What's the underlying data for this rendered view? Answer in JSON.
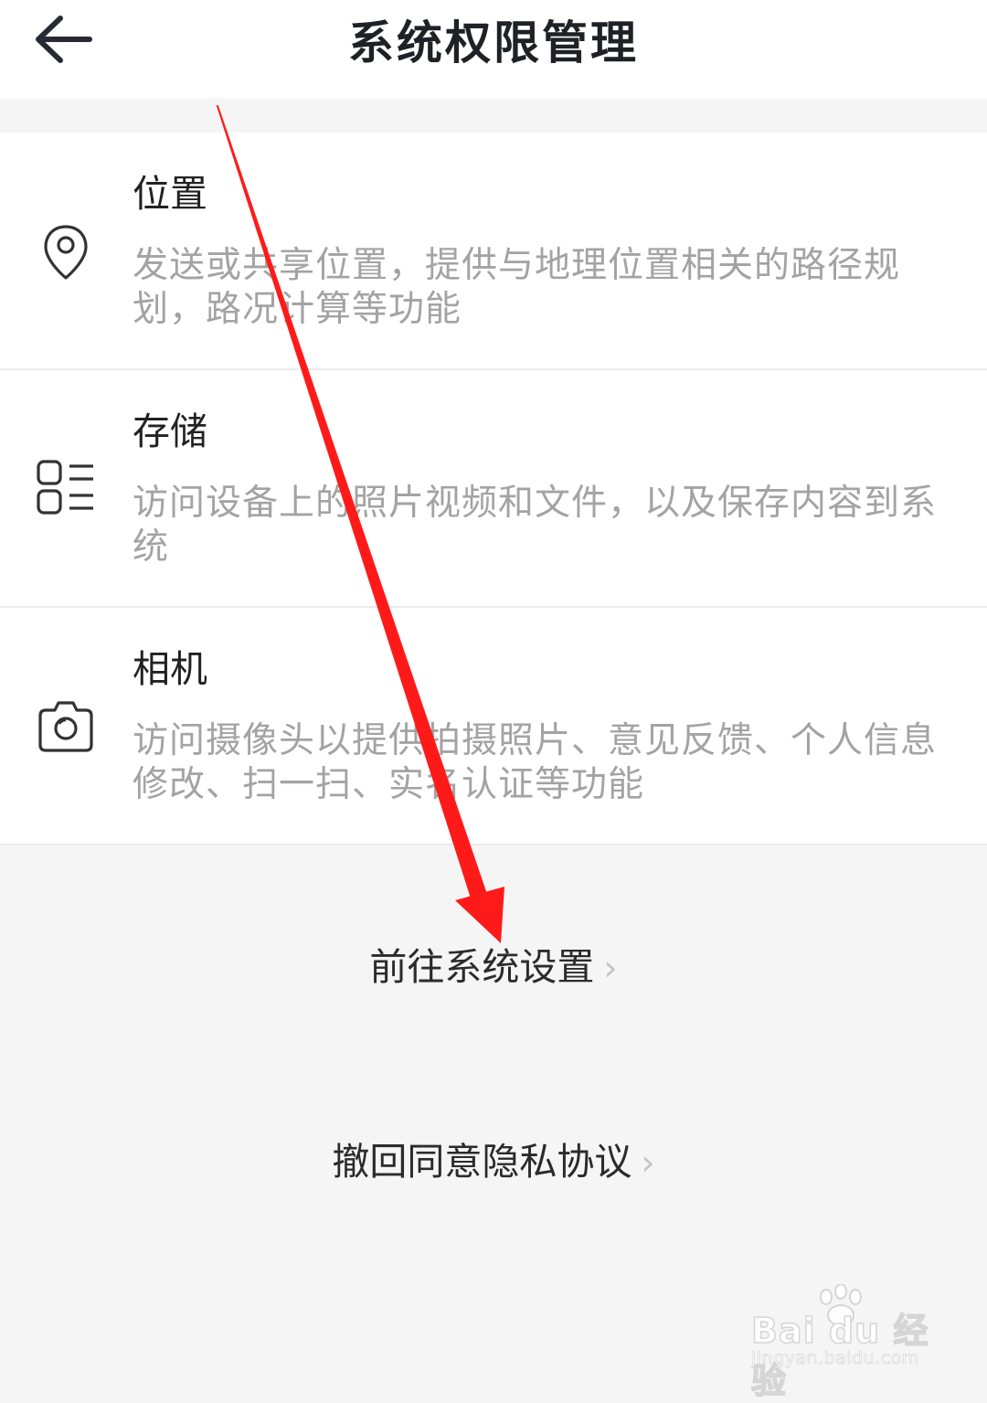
{
  "header": {
    "title": "系统权限管理",
    "back_icon": "arrow-left-icon"
  },
  "permissions": [
    {
      "title": "位置",
      "description": "发送或共享位置，提供与地理位置相关的路径规划，路况计算等功能",
      "icon": "location-pin-icon"
    },
    {
      "title": "存储",
      "description": "访问设备上的照片视频和文件，以及保存内容到系统",
      "icon": "storage-list-icon"
    },
    {
      "title": "相机",
      "description": "访问摄像头以提供拍摄照片、意见反馈、个人信息修改、扫一扫、实名认证等功能",
      "icon": "camera-icon"
    }
  ],
  "actions": {
    "go_settings": "前往系统设置",
    "revoke_privacy": "撤回同意隐私协议",
    "chevron_icon": "chevron-right-icon"
  },
  "annotation": {
    "arrow_color": "#ff1a1a"
  },
  "watermark": {
    "brand": "Bai du 经验",
    "url": "jingyan.baidu.com"
  }
}
